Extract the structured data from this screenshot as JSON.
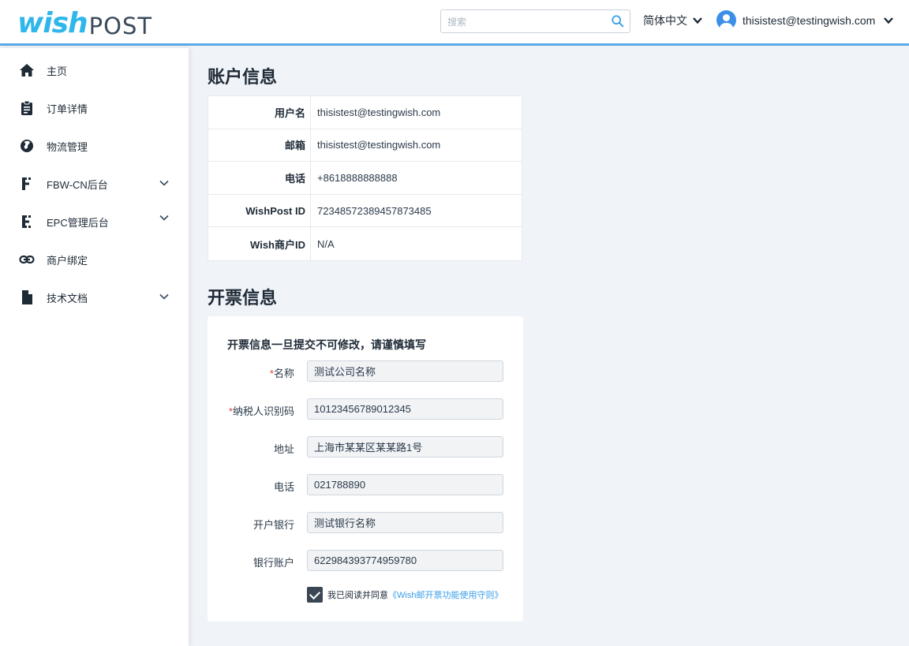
{
  "header": {
    "logo_wish": "wish",
    "logo_post": "POST",
    "search_placeholder": "搜索",
    "language": "简体中文",
    "user_email": "thisistest@testingwish.com"
  },
  "sidebar": {
    "items": [
      {
        "label": "主页",
        "icon": "home-icon"
      },
      {
        "label": "订单详情",
        "icon": "clipboard-icon"
      },
      {
        "label": "物流管理",
        "icon": "globe-icon"
      },
      {
        "label": "FBW-CN后台",
        "icon": "fbw-icon",
        "expandable": true
      },
      {
        "label": "EPC管理后台",
        "icon": "epc-icon",
        "expandable": true
      },
      {
        "label": "商户绑定",
        "icon": "link-icon"
      },
      {
        "label": "技术文档",
        "icon": "document-icon",
        "expandable": true
      }
    ]
  },
  "account": {
    "title": "账户信息",
    "rows": [
      {
        "key": "用户名",
        "value": "thisistest@testingwish.com"
      },
      {
        "key": "邮箱",
        "value": "thisistest@testingwish.com"
      },
      {
        "key": "电话",
        "value": "+8618888888888"
      },
      {
        "key": "WishPost ID",
        "value": "72348572389457873485"
      },
      {
        "key": "Wish商户ID",
        "value": "N/A"
      }
    ]
  },
  "invoice": {
    "title": "开票信息",
    "note": "开票信息一旦提交不可修改，请谨慎填写",
    "fields": [
      {
        "label": "名称",
        "required": "*",
        "value": "测试公司名称"
      },
      {
        "label": "纳税人识别码",
        "required": "*",
        "value": "10123456789012345"
      },
      {
        "label": "地址",
        "required": "",
        "value": "上海市某某区某某路1号"
      },
      {
        "label": "电话",
        "required": "",
        "value": "021788890"
      },
      {
        "label": "开户银行",
        "required": "",
        "value": "测试银行名称"
      },
      {
        "label": "银行账户",
        "required": "",
        "value": "6229843937749597​80"
      }
    ],
    "agree_text": "我已阅读并同意",
    "agree_link": "《Wish邮开票功能使用守则》",
    "agree_checked": true
  },
  "colors": {
    "accent": "#5aa9e6",
    "logo_blue": "#2fb7ec",
    "link": "#3a9de8",
    "required": "#e0403a"
  }
}
